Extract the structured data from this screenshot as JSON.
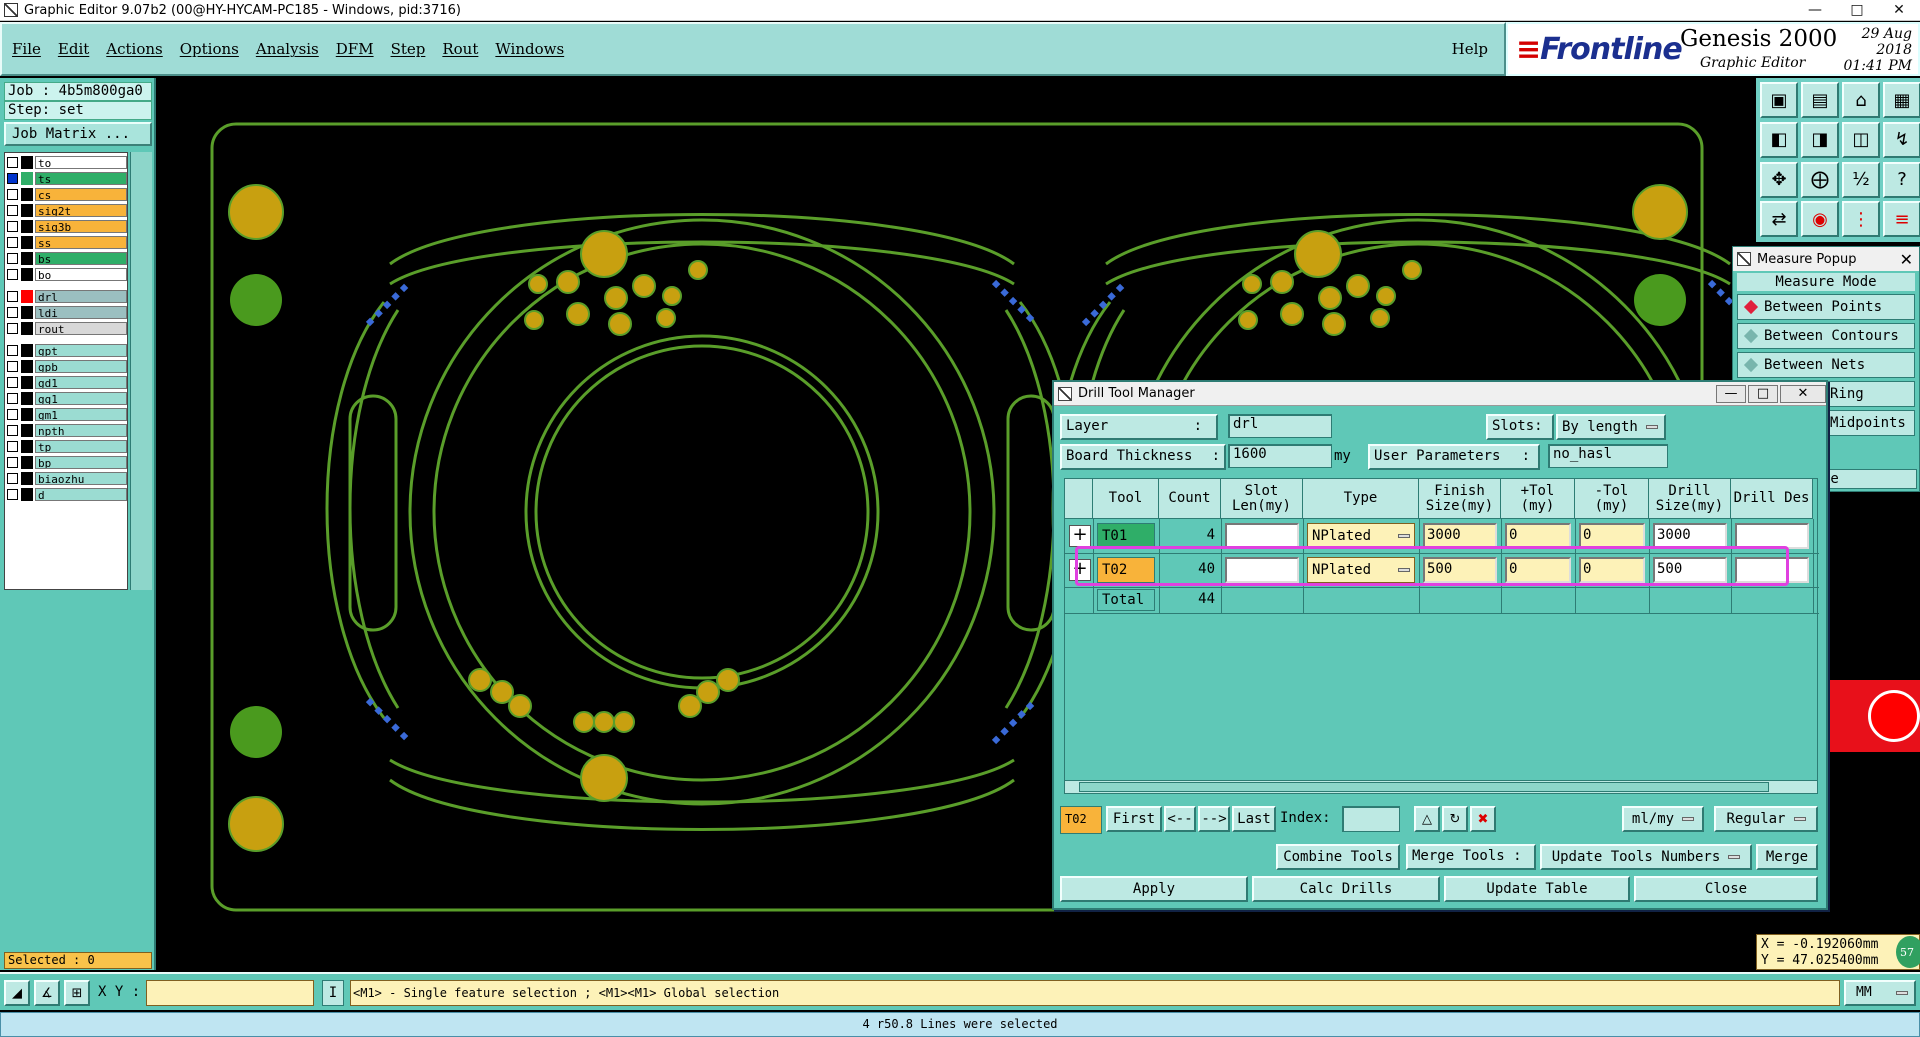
{
  "window": {
    "title": "Graphic Editor 9.07b2 (00@HY-HYCAM-PC185 - Windows, pid:3716)"
  },
  "menu": {
    "items": [
      "File",
      "Edit",
      "Actions",
      "Options",
      "Analysis",
      "DFM",
      "Step",
      "Rout",
      "Windows"
    ],
    "help": "Help"
  },
  "brand": {
    "logo": "Frontline",
    "product": "Genesis 2000",
    "subtitle": "Graphic Editor",
    "date": "29 Aug 2018",
    "time": "01:41 PM"
  },
  "left": {
    "job": "Job : 4b5m800ga0",
    "step": "Step: set",
    "job_matrix": "Job Matrix ...",
    "selected": "Selected : 0",
    "layers": [
      {
        "name": "to",
        "color": "#ffffff",
        "swatch": "#000000",
        "selected": false
      },
      {
        "name": "ts",
        "color": "#2fae68",
        "swatch": "#2fae68",
        "selected": true
      },
      {
        "name": "cs",
        "color": "#f8b33a",
        "swatch": "#000000",
        "selected": false
      },
      {
        "name": "sig2t",
        "color": "#f8b33a",
        "swatch": "#000000",
        "selected": false
      },
      {
        "name": "sig3b",
        "color": "#f8b33a",
        "swatch": "#000000",
        "selected": false
      },
      {
        "name": "ss",
        "color": "#f8b33a",
        "swatch": "#000000",
        "selected": false
      },
      {
        "name": "bs",
        "color": "#2fae68",
        "swatch": "#000000",
        "selected": false
      },
      {
        "name": "bo",
        "color": "#ffffff",
        "swatch": "#000000",
        "selected": false
      },
      {
        "name": "drl",
        "color": "#9bbfc0",
        "swatch": "#ff0000",
        "selected": false
      },
      {
        "name": "ldi",
        "color": "#9bbfc0",
        "swatch": "#000000",
        "selected": false
      },
      {
        "name": "rout",
        "color": "#d8d8d8",
        "swatch": "#000000",
        "selected": false
      },
      {
        "name": "gpt",
        "color": "#9bdcd2",
        "swatch": "#000000",
        "selected": false
      },
      {
        "name": "gpb",
        "color": "#9bdcd2",
        "swatch": "#000000",
        "selected": false
      },
      {
        "name": "gd1",
        "color": "#9bdcd2",
        "swatch": "#000000",
        "selected": false
      },
      {
        "name": "gg1",
        "color": "#9bdcd2",
        "swatch": "#000000",
        "selected": false
      },
      {
        "name": "gm1",
        "color": "#9bdcd2",
        "swatch": "#000000",
        "selected": false
      },
      {
        "name": "npth",
        "color": "#9bdcd2",
        "swatch": "#000000",
        "selected": false
      },
      {
        "name": "tp",
        "color": "#9bdcd2",
        "swatch": "#000000",
        "selected": false
      },
      {
        "name": "bp",
        "color": "#9bdcd2",
        "swatch": "#000000",
        "selected": false
      },
      {
        "name": "biaozhu",
        "color": "#9bdcd2",
        "swatch": "#000000",
        "selected": false
      },
      {
        "name": "d",
        "color": "#9bdcd2",
        "swatch": "#000000",
        "selected": false
      }
    ]
  },
  "tools_icons": [
    "panel-up-icon",
    "panel-down-icon",
    "home-icon",
    "window-icon",
    "panel-left-icon",
    "panel-right-icon",
    "panel-split-icon",
    "zigzag-icon",
    "fit-all-icon",
    "zoom-icon",
    "scale-icon",
    "help-icon",
    "measure-icon",
    "snap-icon",
    "grid-icon",
    "layers-icon"
  ],
  "measure": {
    "title": "Measure Popup",
    "mode_label": "Measure Mode",
    "options": [
      {
        "label": "Between Points",
        "active": true
      },
      {
        "label": "Between Contours",
        "active": false
      },
      {
        "label": "Between Nets",
        "active": false
      },
      {
        "label": "Ring",
        "active": false
      },
      {
        "label": "Midpoints",
        "active": false
      }
    ],
    "close_label": "se"
  },
  "coords": {
    "x": "X = -0.192060mm",
    "y": "Y = 47.025400mm",
    "badge": "57"
  },
  "drill": {
    "title": "Drill Tool Manager",
    "layer_label": "Layer",
    "layer_value": "drl",
    "slots_label": "Slots:",
    "slots_value": "By length",
    "thickness_label": "Board Thickness",
    "thickness_value": "1600",
    "thickness_unit": "my",
    "user_params_label": "User Parameters",
    "user_params_value": "no_hasl",
    "columns": [
      "Tool",
      "Count",
      "Slot Len(my)",
      "Type",
      "Finish Size(my)",
      "+Tol (my)",
      "-Tol (my)",
      "Drill Size(my)",
      "Drill Des"
    ],
    "rows": [
      {
        "tool": "T01",
        "count": "4",
        "slot": "",
        "type": "NPlated",
        "finish": "3000",
        "ptol": "0",
        "mtol": "0",
        "drill": "3000",
        "des": ""
      },
      {
        "tool": "T02",
        "count": "40",
        "slot": "",
        "type": "NPlated",
        "finish": "500",
        "ptol": "0",
        "mtol": "0",
        "drill": "500",
        "des": ""
      }
    ],
    "total_label": "Total",
    "total_count": "44",
    "nav": {
      "current": "T02",
      "first": "First",
      "prev": "<--",
      "next": "-->",
      "last": "Last",
      "index_label": "Index:",
      "index_value": "",
      "units": "ml/my",
      "mode": "Regular"
    },
    "actions": {
      "combine": "Combine Tools",
      "merge_label": "Merge Tools :",
      "update_numbers": "Update Tools Numbers",
      "merge": "Merge",
      "apply": "Apply",
      "calc": "Calc Drills",
      "update_table": "Update Table",
      "close": "Close"
    }
  },
  "status": {
    "xy_label": "X Y :",
    "sep": "I",
    "hint": "<M1> - Single feature selection ; <M1><M1> Global selection",
    "units": "MM",
    "message": "4 r50.8 Lines were selected"
  },
  "colors": {
    "panel": "#5fc8b7",
    "board_outline": "#5a9e2a",
    "pad_large": "#c8a010",
    "pad_green": "#4a9a1e",
    "highlight": "#e040e0"
  }
}
